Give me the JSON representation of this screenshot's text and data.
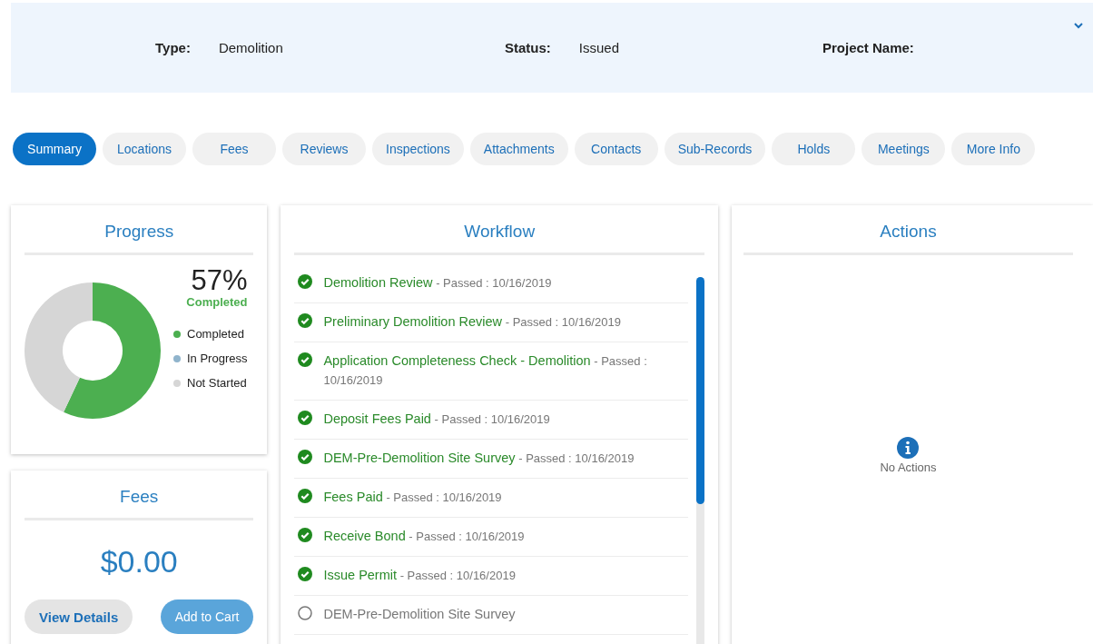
{
  "header": {
    "fields": [
      {
        "label": "Type:",
        "value": "Demolition"
      },
      {
        "label": "Status:",
        "value": "Issued"
      },
      {
        "label": "Project Name:"
      }
    ]
  },
  "tabs": [
    {
      "label": "Summary",
      "selected": true
    },
    {
      "label": "Locations",
      "selected": false
    },
    {
      "label": "Fees",
      "selected": false
    },
    {
      "label": "Reviews",
      "selected": false
    },
    {
      "label": "Inspections",
      "selected": false
    },
    {
      "label": "Attachments",
      "selected": false
    },
    {
      "label": "Contacts",
      "selected": false
    },
    {
      "label": "Sub-Records",
      "selected": false
    },
    {
      "label": "Holds",
      "selected": false
    },
    {
      "label": "Meetings",
      "selected": false
    },
    {
      "label": "More Info",
      "selected": false
    }
  ],
  "progress": {
    "title": "Progress",
    "percent": "57%",
    "percent_caption": "Completed",
    "chart_data": {
      "type": "donut",
      "categories": [
        "Completed",
        "In Progress",
        "Not Started"
      ],
      "values": [
        57,
        0,
        43
      ]
    },
    "legend": [
      {
        "color": "#4caf50"
      },
      {
        "color": "#90b4cc"
      },
      {
        "color": "#d6d6d6"
      }
    ]
  },
  "fees": {
    "title": "Fees",
    "amount": "$0.00",
    "buttons": [
      {
        "label": "View Details",
        "kind": "secondary"
      },
      {
        "label": "Add to Cart",
        "kind": "primary"
      }
    ]
  },
  "workflow": {
    "title": "Workflow",
    "items": [
      {
        "name": "Demolition Review",
        "status": "- Passed : 10/16/2019",
        "kind": "passed"
      },
      {
        "name": "Preliminary Demolition Review",
        "status": "- Passed : 10/16/2019",
        "kind": "passed"
      },
      {
        "name": "Application Completeness Check - Demolition",
        "status": "- Passed : 10/16/2019",
        "kind": "passed"
      },
      {
        "name": "Deposit Fees Paid",
        "status": "- Passed : 10/16/2019",
        "kind": "passed"
      },
      {
        "name": "DEM-Pre-Demolition Site Survey",
        "status": "- Passed : 10/16/2019",
        "kind": "passed"
      },
      {
        "name": "Fees Paid",
        "status": "- Passed : 10/16/2019",
        "kind": "passed"
      },
      {
        "name": "Receive Bond",
        "status": "- Passed : 10/16/2019",
        "kind": "passed"
      },
      {
        "name": "Issue Permit",
        "status": "- Passed : 10/16/2019",
        "kind": "passed"
      },
      {
        "name": "DEM-Pre-Demolition Site Survey",
        "kind": "pending"
      }
    ]
  },
  "actions": {
    "title": "Actions",
    "empty_message": "No Actions"
  }
}
